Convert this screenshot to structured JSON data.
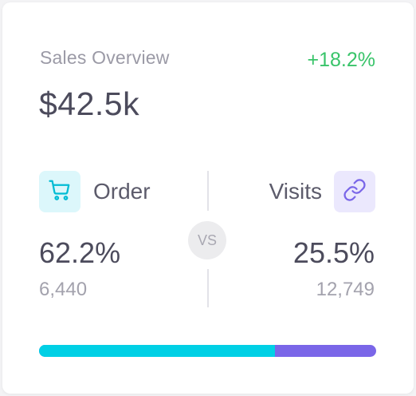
{
  "card": {
    "title": "Sales Overview",
    "change": "+18.2%",
    "total": "$42.5k"
  },
  "order": {
    "label": "Order",
    "percent": "62.2%",
    "count": "6,440",
    "icon": "cart-icon"
  },
  "visits": {
    "label": "Visits",
    "percent": "25.5%",
    "count": "12,749",
    "icon": "link-icon"
  },
  "vs": "VS",
  "progress": {
    "order_fraction": 0.7,
    "visits_fraction": 0.3
  },
  "colors": {
    "positive": "#39c46a",
    "order_accent": "#00d0e5",
    "order_icon_bg": "#dcf7fb",
    "visits_accent": "#7a66e8",
    "visits_icon_bg": "#ebe8fd"
  }
}
